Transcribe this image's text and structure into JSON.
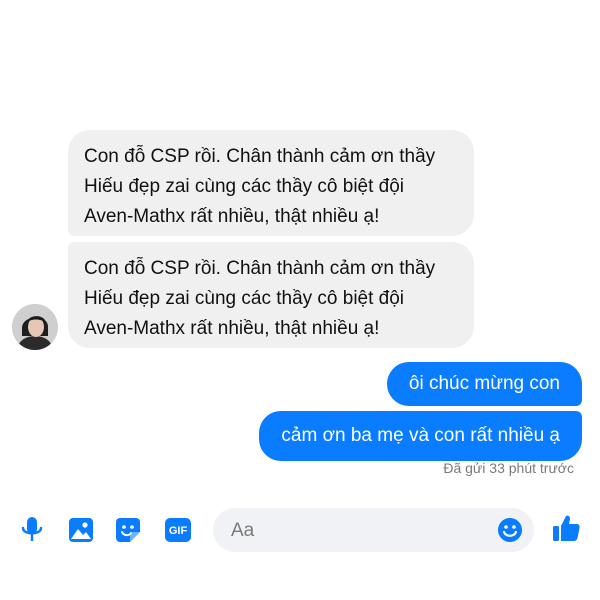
{
  "colors": {
    "accent": "#0a7cff",
    "incoming_bubble": "#f0f0f0",
    "outgoing_text": "#ffffff",
    "status_text": "#7a7a7a",
    "input_background": "#f0f2f5"
  },
  "messages": {
    "incoming": [
      {
        "lines": [
          "Con đỗ CSP rồi. Chân thành cảm ơn thầy",
          "Hiếu đẹp zai cùng các thầy cô biệt đội",
          "Aven-Mathx rất nhiều, thật nhiều ạ!"
        ]
      },
      {
        "lines": [
          "Con đỗ CSP rồi. Chân thành cảm ơn thầy",
          "Hiếu đẹp zai cùng các thầy cô biệt đội",
          "Aven-Mathx rất nhiều, thật nhiều ạ!"
        ]
      }
    ],
    "outgoing": [
      {
        "text": "ôi chúc mừng con"
      },
      {
        "text": "cảm ơn ba mẹ và con rất nhiều ạ"
      }
    ],
    "status": "Đã gửi 33 phút trước"
  },
  "composer": {
    "placeholder": "Aa",
    "value": "",
    "icons": [
      "microphone-icon",
      "image-icon",
      "sticker-icon",
      "gif-icon",
      "emoji-icon",
      "like-icon"
    ],
    "gif_label": "GIF"
  }
}
